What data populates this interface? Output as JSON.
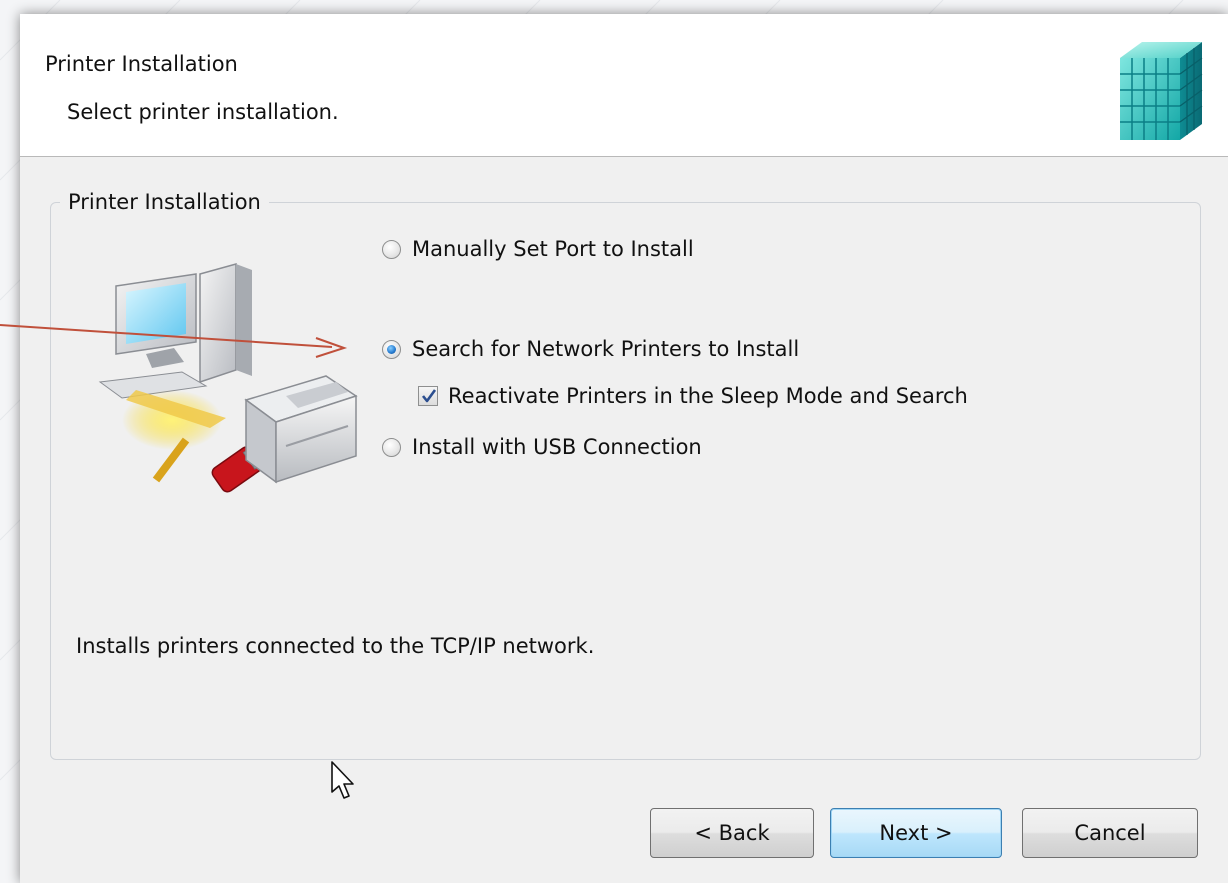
{
  "header": {
    "title": "Printer Installation",
    "subtitle": "Select printer installation."
  },
  "group": {
    "legend": "Printer Installation",
    "options": [
      {
        "label": "Manually Set Port to Install",
        "selected": false
      },
      {
        "label": "Search for Network Printers to Install",
        "selected": true
      },
      {
        "label": "Install with USB Connection",
        "selected": false
      }
    ],
    "sleep_checkbox": {
      "label": "Reactivate Printers in the Sleep Mode and Search",
      "checked": true
    },
    "description": "Installs printers connected to the TCP/IP network."
  },
  "buttons": {
    "back": "< Back",
    "next": "Next >",
    "cancel": "Cancel"
  },
  "colors": {
    "dialog_bg": "#f0f0f0",
    "header_bg": "#ffffff",
    "annotation_arrow": "#c0503b",
    "default_button": "#a7d9f5"
  }
}
